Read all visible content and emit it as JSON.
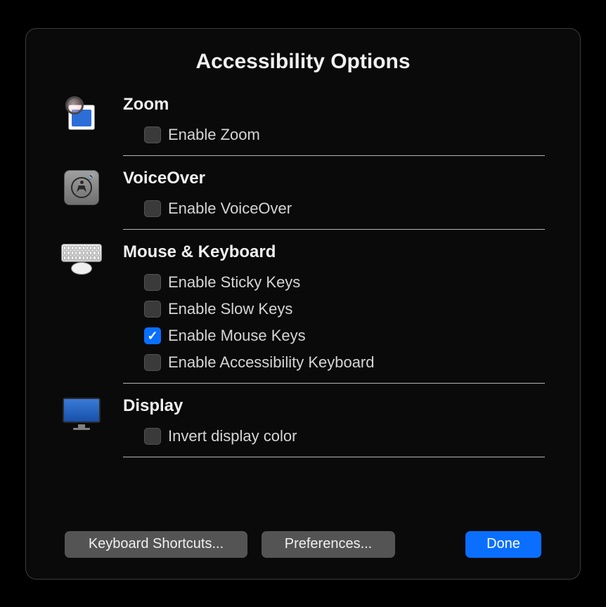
{
  "title": "Accessibility Options",
  "sections": {
    "zoom": {
      "title": "Zoom",
      "options": {
        "enable_zoom": {
          "label": "Enable Zoom",
          "checked": false
        }
      }
    },
    "voiceover": {
      "title": "VoiceOver",
      "options": {
        "enable_voiceover": {
          "label": "Enable VoiceOver",
          "checked": false
        }
      }
    },
    "mouse_keyboard": {
      "title": "Mouse & Keyboard",
      "options": {
        "enable_sticky_keys": {
          "label": "Enable Sticky Keys",
          "checked": false
        },
        "enable_slow_keys": {
          "label": "Enable Slow Keys",
          "checked": false
        },
        "enable_mouse_keys": {
          "label": "Enable Mouse Keys",
          "checked": true
        },
        "enable_accessibility_keyboard": {
          "label": "Enable Accessibility Keyboard",
          "checked": false
        }
      }
    },
    "display": {
      "title": "Display",
      "options": {
        "invert_display_color": {
          "label": "Invert display color",
          "checked": false
        }
      }
    }
  },
  "footer": {
    "keyboard_shortcuts": "Keyboard Shortcuts...",
    "preferences": "Preferences...",
    "done": "Done"
  }
}
